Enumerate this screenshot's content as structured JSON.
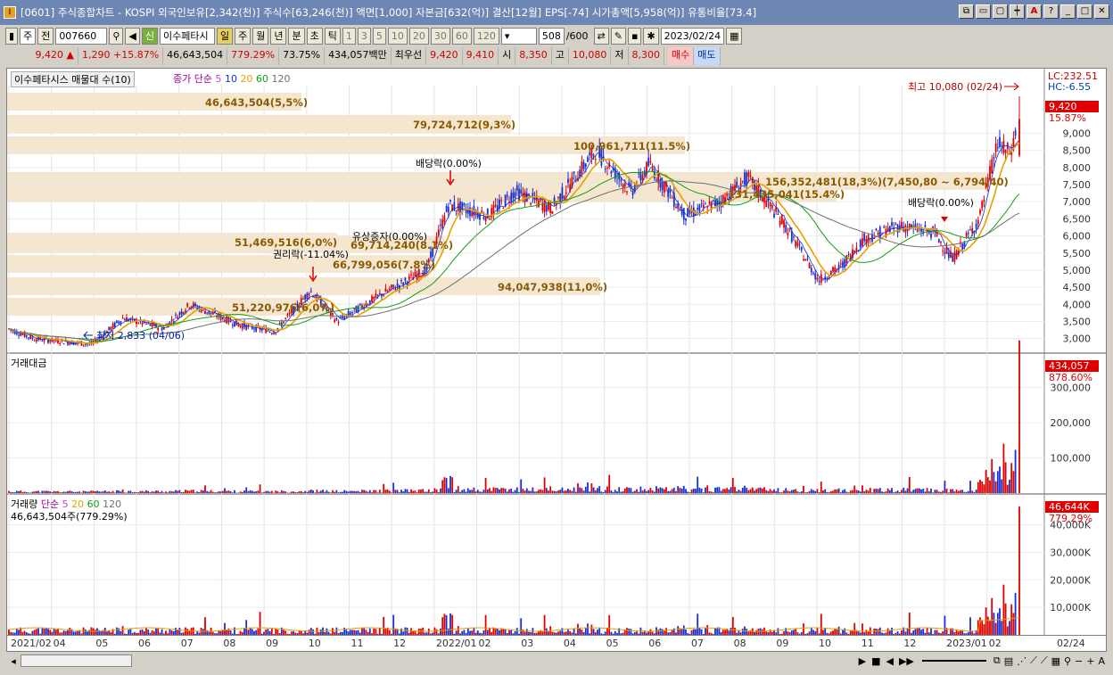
{
  "window": {
    "title": "[0601] 주식종합차트 - KOSPI 외국인보유[2,342(천)] 주식수[63,246(천)] 액면[1,000] 자본금[632(억)] 결산[12월] EPS[-74] 시가총액[5,958(억)] 유통비율[73.4]",
    "icon": "I"
  },
  "toolbar": {
    "period": "주",
    "prev": "전",
    "code": "007660",
    "credit": "신",
    "name": "이수페타시",
    "units": [
      "일",
      "주",
      "월",
      "년",
      "분",
      "초",
      "틱"
    ],
    "nums": [
      "1",
      "3",
      "5",
      "10",
      "20",
      "30",
      "60",
      "120"
    ],
    "count": "508",
    "count_total": "/600",
    "date": "2023/02/24"
  },
  "quote": {
    "price": "9,420",
    "change": "1,290",
    "rate": "+15.87%",
    "volume": "46,643,504",
    "vol_rate": "779.29%",
    "ratio": "73.75%",
    "amount": "434,057백만",
    "best_label": "최우선",
    "ask": "9,420",
    "bid": "9,410",
    "open_label": "시",
    "open": "8,350",
    "high_label": "고",
    "high": "10,080",
    "low_label": "저",
    "low": "8,300",
    "buy": "매수",
    "sell": "매도"
  },
  "price_pane": {
    "label": "이수페타시스 매물대 수(10)",
    "ma_label": "종가 단순",
    "ma_periods": [
      "5",
      "10",
      "20",
      "60",
      "120"
    ],
    "lc": "LC:232.51",
    "hc": "HC:-6.55",
    "cur_price": "9,420",
    "cur_rate": "15.87%",
    "high_note": "최고 10,080 (02/24)",
    "low_note": "최저 2,833 (04/06)",
    "yticks": [
      "9,000",
      "8,500",
      "8,000",
      "7,500",
      "7,000",
      "6,500",
      "6,000",
      "5,500",
      "5,000",
      "4,500",
      "4,000",
      "3,500",
      "3,000"
    ],
    "profile": [
      {
        "text": "46,643,504(5,5%)"
      },
      {
        "text": "79,724,712(9,3%)"
      },
      {
        "text": "100,961,711(11.5%)"
      },
      {
        "text": "156,352,481(18,3%)(7,450,80 ~ 6,794,40)"
      },
      {
        "text": "131,435,041(15.4%)"
      },
      {
        "text": "69,714,240(8.1%)"
      },
      {
        "text": "66,799,056(7.8%)"
      },
      {
        "text": "94,047,938(11,0%)"
      },
      {
        "text": "51,220,976(6,0%)"
      },
      {
        "text": "51,469,516(6,0%)"
      }
    ],
    "events": [
      {
        "text": "권리락(-11.04%)"
      },
      {
        "text": "유상증자(0.00%)"
      },
      {
        "text": "배당락(0.00%)"
      },
      {
        "text": "배당락(0.00%)"
      }
    ]
  },
  "amount_pane": {
    "label": "거래대금",
    "cur": "434,057",
    "rate": "878.60%",
    "yticks": [
      "300,000",
      "200,000",
      "100,000"
    ]
  },
  "volume_pane": {
    "label": "거래량",
    "ma_label": "단순",
    "ma_periods": [
      "5",
      "20",
      "60",
      "120"
    ],
    "sub": "46,643,504주(779.29%)",
    "cur": "46,644K",
    "rate": "779.29%",
    "yticks": [
      "40,000K",
      "30,000K",
      "20,000K",
      "10,000K"
    ]
  },
  "xaxis": [
    "2021/02",
    "04",
    "05",
    "06",
    "07",
    "08",
    "09",
    "10",
    "11",
    "12",
    "2022/01",
    "02",
    "03",
    "04",
    "05",
    "06",
    "07",
    "08",
    "09",
    "10",
    "11",
    "12",
    "2023/01",
    "02"
  ],
  "xaxis_last": "02/24",
  "colors": {
    "up": "#e00000",
    "down": "#1830d0",
    "ma5": "#d040d0",
    "ma20": "#e8a000",
    "ma60": "#10a010",
    "ma120": "#707070",
    "profile": "#f5e6d0"
  }
}
